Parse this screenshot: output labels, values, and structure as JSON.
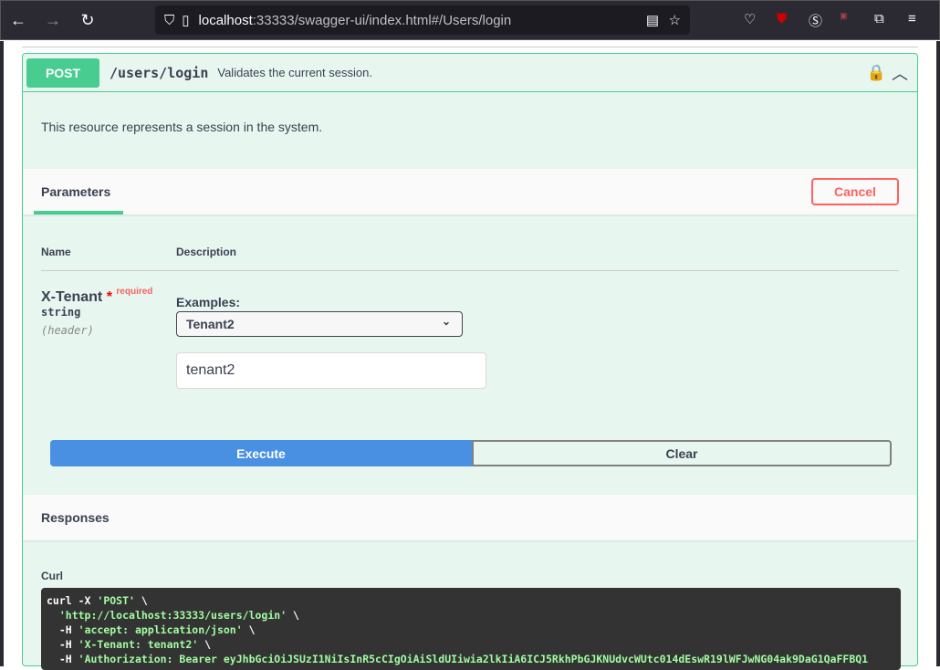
{
  "browser": {
    "url_host": "localhost",
    "url_rest": ":33333/swagger-ui/index.html#/Users/login"
  },
  "operation": {
    "method": "POST",
    "path": "/users/login",
    "summary": "Validates the current session.",
    "description": "This resource represents a session in the system.",
    "color": "#49cc90"
  },
  "parameters": {
    "title": "Parameters",
    "cancel": "Cancel",
    "col_name": "Name",
    "col_description": "Description",
    "items": [
      {
        "name": "X-Tenant",
        "star": "*",
        "required": "required",
        "type": "string",
        "in": "(header)",
        "examples_label": "Examples:",
        "example_selected": "Tenant2",
        "value": "tenant2"
      }
    ]
  },
  "actions": {
    "execute": "Execute",
    "clear": "Clear"
  },
  "responses": {
    "title": "Responses",
    "curl_label": "Curl",
    "curl": {
      "l1a": "curl -X ",
      "l1b": "'POST'",
      "l1c": " \\",
      "l2": "'http://localhost:33333/users/login'",
      "l3": "'accept: application/json'",
      "l4": "'X-Tenant: tenant2'",
      "l5": "'Authorization: Bearer eyJhbGciOiJSUzI1NiIsInR5cCIgOiAiSldUIiwia2lkIiA6ICJ5RkhPbGJKNUdvcWUtc014dEswR19lWFJwNG04ak9DaG1QaFFBQ1",
      "h": "-H ",
      "bs": " \\"
    }
  }
}
